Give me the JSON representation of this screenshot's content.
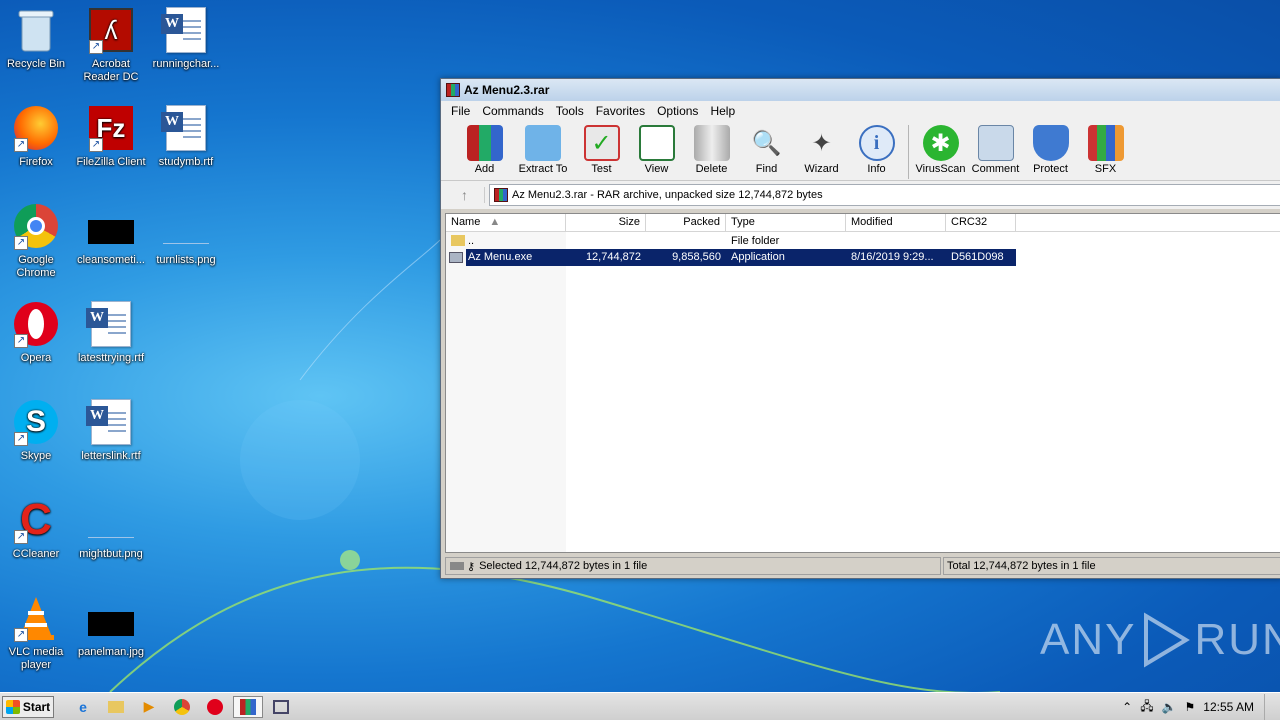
{
  "desktop": {
    "icons": [
      {
        "label": "Recycle Bin",
        "icon": "recycle-bin-icon"
      },
      {
        "label": "Acrobat Reader DC",
        "icon": "acrobat-icon"
      },
      {
        "label": "runningchar...",
        "icon": "word-doc-icon"
      },
      {
        "label": "Firefox",
        "icon": "firefox-icon"
      },
      {
        "label": "FileZilla Client",
        "icon": "filezilla-icon"
      },
      {
        "label": "studymb.rtf",
        "icon": "word-doc-icon"
      },
      {
        "label": "Google Chrome",
        "icon": "chrome-icon"
      },
      {
        "label": "cleansometi...",
        "icon": "image-thumb-icon"
      },
      {
        "label": "turnlists.png",
        "icon": "image-thumb-icon"
      },
      {
        "label": "Opera",
        "icon": "opera-icon"
      },
      {
        "label": "latesttrying.rtf",
        "icon": "word-doc-icon"
      },
      {
        "label": "Skype",
        "icon": "skype-icon"
      },
      {
        "label": "letterslink.rtf",
        "icon": "word-doc-icon"
      },
      {
        "label": "CCleaner",
        "icon": "ccleaner-icon"
      },
      {
        "label": "mightbut.png",
        "icon": "image-thumb-icon"
      },
      {
        "label": "VLC media player",
        "icon": "vlc-icon"
      },
      {
        "label": "panelman.jpg",
        "icon": "image-thumb-icon"
      }
    ]
  },
  "window": {
    "title": "Az Menu2.3.rar",
    "menu": [
      "File",
      "Commands",
      "Tools",
      "Favorites",
      "Options",
      "Help"
    ],
    "toolbar": [
      "Add",
      "Extract To",
      "Test",
      "View",
      "Delete",
      "Find",
      "Wizard",
      "Info",
      "VirusScan",
      "Comment",
      "Protect",
      "SFX"
    ],
    "address": "Az Menu2.3.rar - RAR archive, unpacked size 12,744,872 bytes",
    "columns": [
      "Name",
      "Size",
      "Packed",
      "Type",
      "Modified",
      "CRC32"
    ],
    "rows": [
      {
        "name": "..",
        "size": "",
        "packed": "",
        "type": "File folder",
        "modified": "",
        "crc": ""
      },
      {
        "name": "Az Menu.exe",
        "size": "12,744,872",
        "packed": "9,858,560",
        "type": "Application",
        "modified": "8/16/2019 9:29...",
        "crc": "D561D098"
      }
    ],
    "status_left": "Selected 12,744,872 bytes in 1 file",
    "status_right": "Total 12,744,872 bytes in 1 file"
  },
  "taskbar": {
    "start_label": "Start",
    "clock": "12:55 AM"
  },
  "watermark": {
    "left": "ANY",
    "right": "RUN"
  },
  "colors": {
    "selection": "#0a246a",
    "desktop": "#1576cf"
  }
}
